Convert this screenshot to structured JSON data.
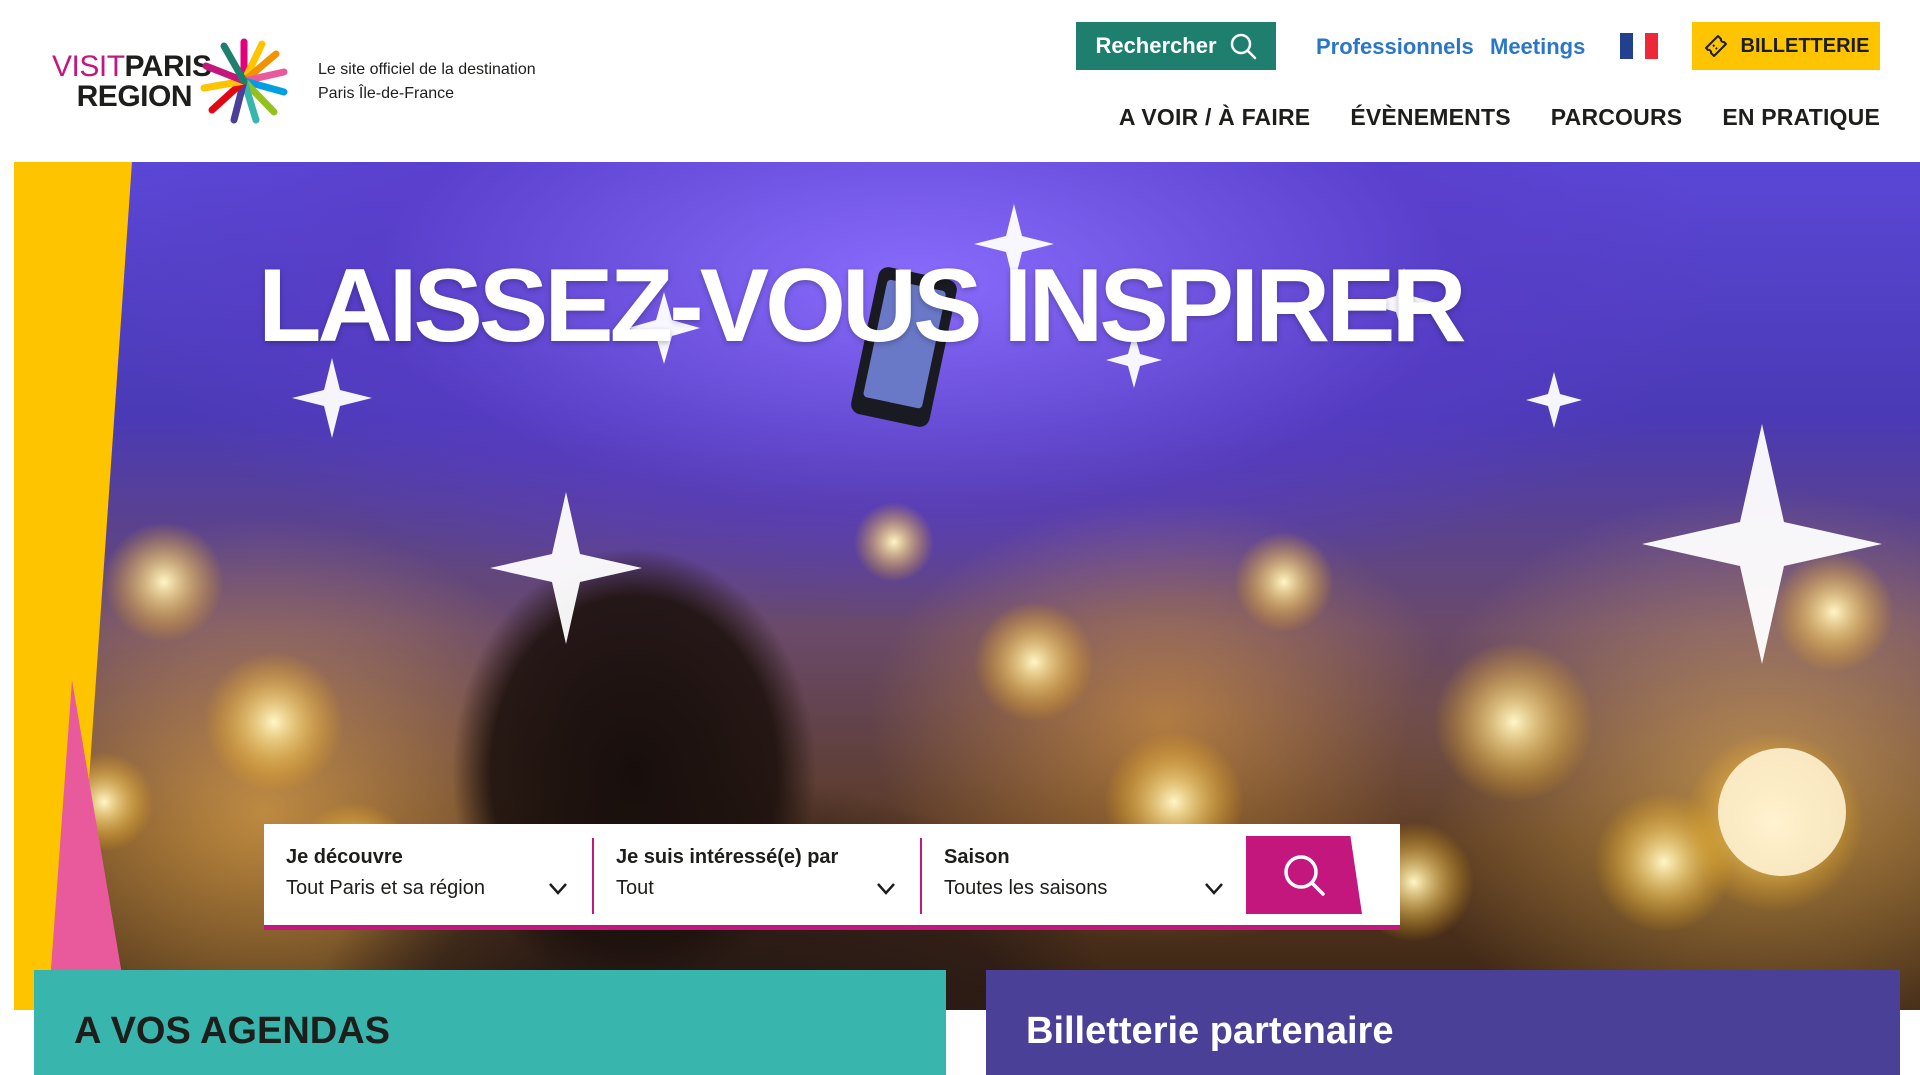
{
  "header": {
    "logo_text_line1_visit": "VISIT",
    "logo_text_line1_paris": "PARIS",
    "logo_text_line2": "REGION",
    "tagline_line1": "Le site officiel de la destination",
    "tagline_line2": "Paris Île-de-France",
    "search_button_label": "Rechercher",
    "links": {
      "professionals": "Professionnels",
      "meetings": "Meetings"
    },
    "language_flag": "fr-flag-icon",
    "ticket_button_label": "BILLETTERIE",
    "nav": [
      "A VOIR / À FAIRE",
      "ÉVÈNEMENTS",
      "PARCOURS",
      "EN PRATIQUE"
    ]
  },
  "hero": {
    "title": "LAISSEZ-VOUS INSPIRER"
  },
  "filters": [
    {
      "label": "Je découvre",
      "value": "Tout Paris et sa région"
    },
    {
      "label": "Je suis intéressé(e) par",
      "value": "Tout"
    },
    {
      "label": "Saison",
      "value": "Toutes les saisons"
    }
  ],
  "cards": {
    "agenda_title": "A VOS AGENDAS",
    "ticket_title": "Billetterie partenaire"
  },
  "colors": {
    "brand_pink": "#c4177e",
    "brand_yellow": "#ffc400",
    "search_green": "#1e7f6f",
    "link_blue": "#2a77c9",
    "agenda_teal": "#38b6ad",
    "ticket_purple": "#4a4098"
  }
}
